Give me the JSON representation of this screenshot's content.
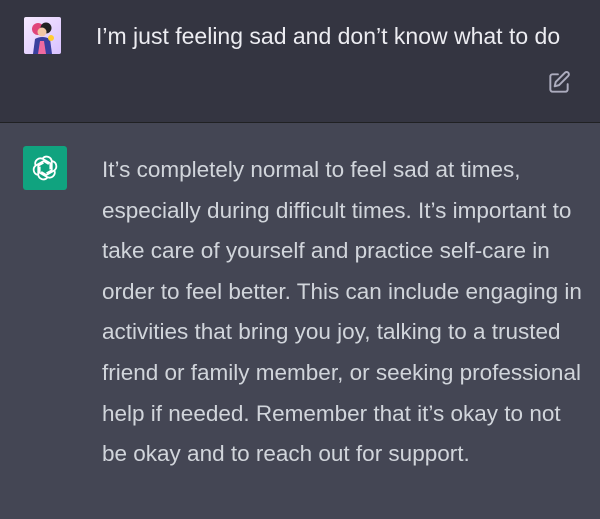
{
  "conversation": {
    "user_message": {
      "avatar_icon": "user-avatar-illustration-icon",
      "text": "I’m just feeling sad and don’t know what to do",
      "edit_icon": "edit-pencil-square-icon"
    },
    "assistant_message": {
      "avatar_icon": "openai-logo-icon",
      "text": "It’s completely normal to feel sad at times, especially during difficult times. It’s important to take care of yourself and practice self-care in order to feel better. This can include engaging in activities that bring you joy, talking to a trusted friend or family member, or seeking professional help if needed. Remember that it’s okay to not be okay and to reach out for support."
    }
  },
  "colors": {
    "user_bg": "#343541",
    "assistant_bg": "#444654",
    "accent_green": "#10a37f",
    "user_text": "#ececf1",
    "assistant_text": "#d1d5db"
  }
}
